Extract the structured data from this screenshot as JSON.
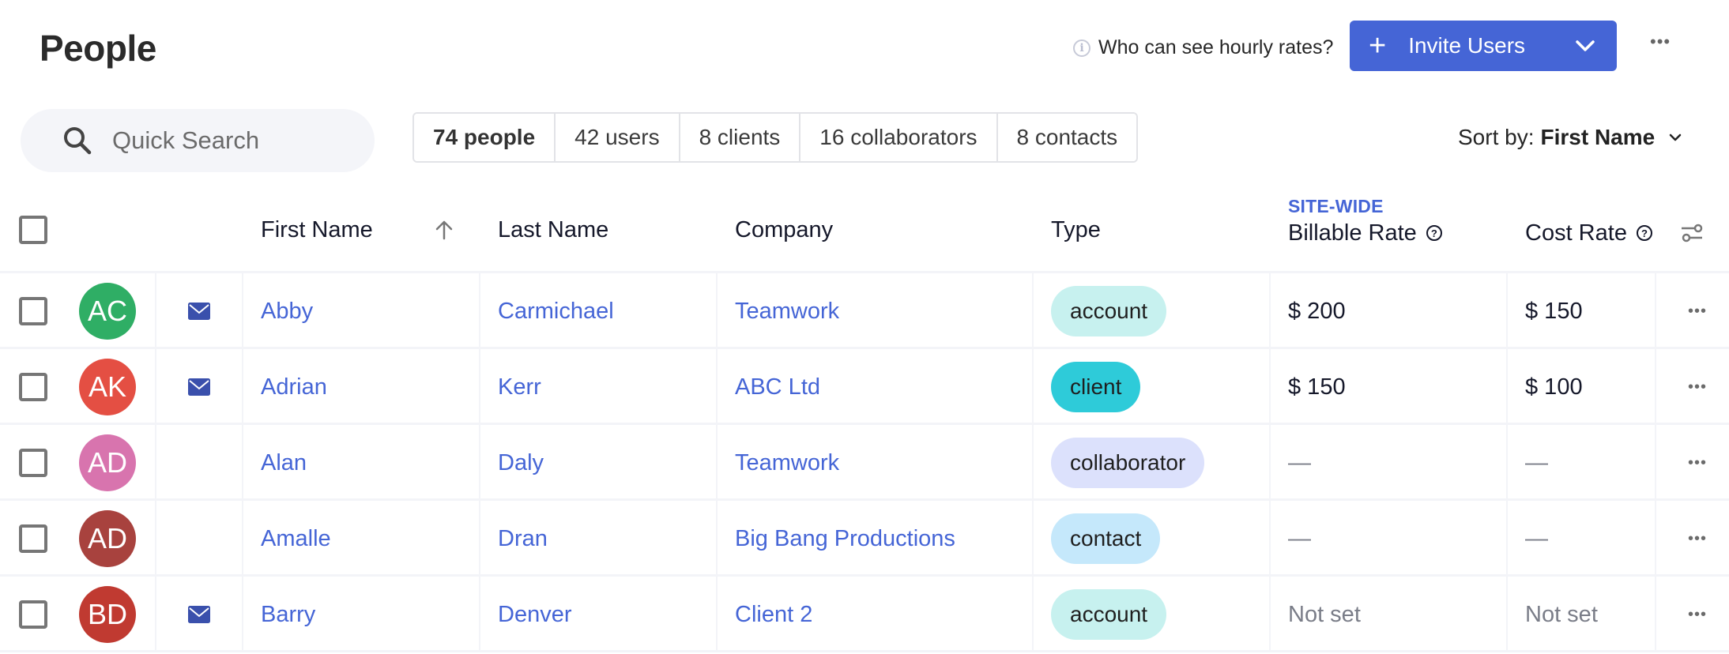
{
  "page": {
    "title": "People"
  },
  "header": {
    "rates_help": "Who can see hourly rates?",
    "invite_button": {
      "label": "Invite Users",
      "color": "#4565d6"
    },
    "more_label": "•••"
  },
  "search": {
    "placeholder": "Quick Search",
    "value": ""
  },
  "filters": [
    {
      "label": "74 people",
      "active": true
    },
    {
      "label": "42 users",
      "active": false
    },
    {
      "label": "8 clients",
      "active": false
    },
    {
      "label": "16 collaborators",
      "active": false
    },
    {
      "label": "8 contacts",
      "active": false
    }
  ],
  "sort": {
    "prefix": "Sort by:",
    "value": "First Name"
  },
  "table": {
    "columns": {
      "first_name": "First Name",
      "last_name": "Last Name",
      "company": "Company",
      "type": "Type",
      "site_wide": "SITE-WIDE",
      "billable_rate": "Billable Rate",
      "cost_rate": "Cost Rate"
    },
    "sort_direction": "ascending",
    "rows": [
      {
        "initials": "AC",
        "avatar_color": "#2fae65",
        "has_email": true,
        "first": "Abby",
        "last": "Carmichael",
        "company": "Teamwork",
        "type": "account",
        "type_color": "#c7f1ef",
        "billable": "$ 200",
        "cost": "$ 150",
        "rates_set": true
      },
      {
        "initials": "AK",
        "avatar_color": "#e44f43",
        "has_email": true,
        "first": "Adrian",
        "last": "Kerr",
        "company": "ABC Ltd",
        "type": "client",
        "type_color": "#2ecbd9",
        "billable": "$ 150",
        "cost": "$ 100",
        "rates_set": true
      },
      {
        "initials": "AD",
        "avatar_color": "#d874ae",
        "has_email": false,
        "first": "Alan",
        "last": "Daly",
        "company": "Teamwork",
        "type": "collaborator",
        "type_color": "#dce1fc",
        "billable": "—",
        "cost": "—",
        "rates_set": false
      },
      {
        "initials": "AD",
        "avatar_color": "#a8423e",
        "has_email": false,
        "first": "Amalle",
        "last": "Dran",
        "company": "Big Bang Productions",
        "type": "contact",
        "type_color": "#c5e8fb",
        "billable": "—",
        "cost": "—",
        "rates_set": false
      },
      {
        "initials": "BD",
        "avatar_color": "#c03a31",
        "has_email": true,
        "first": "Barry",
        "last": "Denver",
        "company": "Client 2",
        "type": "account",
        "type_color": "#c7f1ef",
        "billable": "Not set",
        "cost": "Not set",
        "rates_set": false
      }
    ],
    "row_more_label": "•••"
  }
}
